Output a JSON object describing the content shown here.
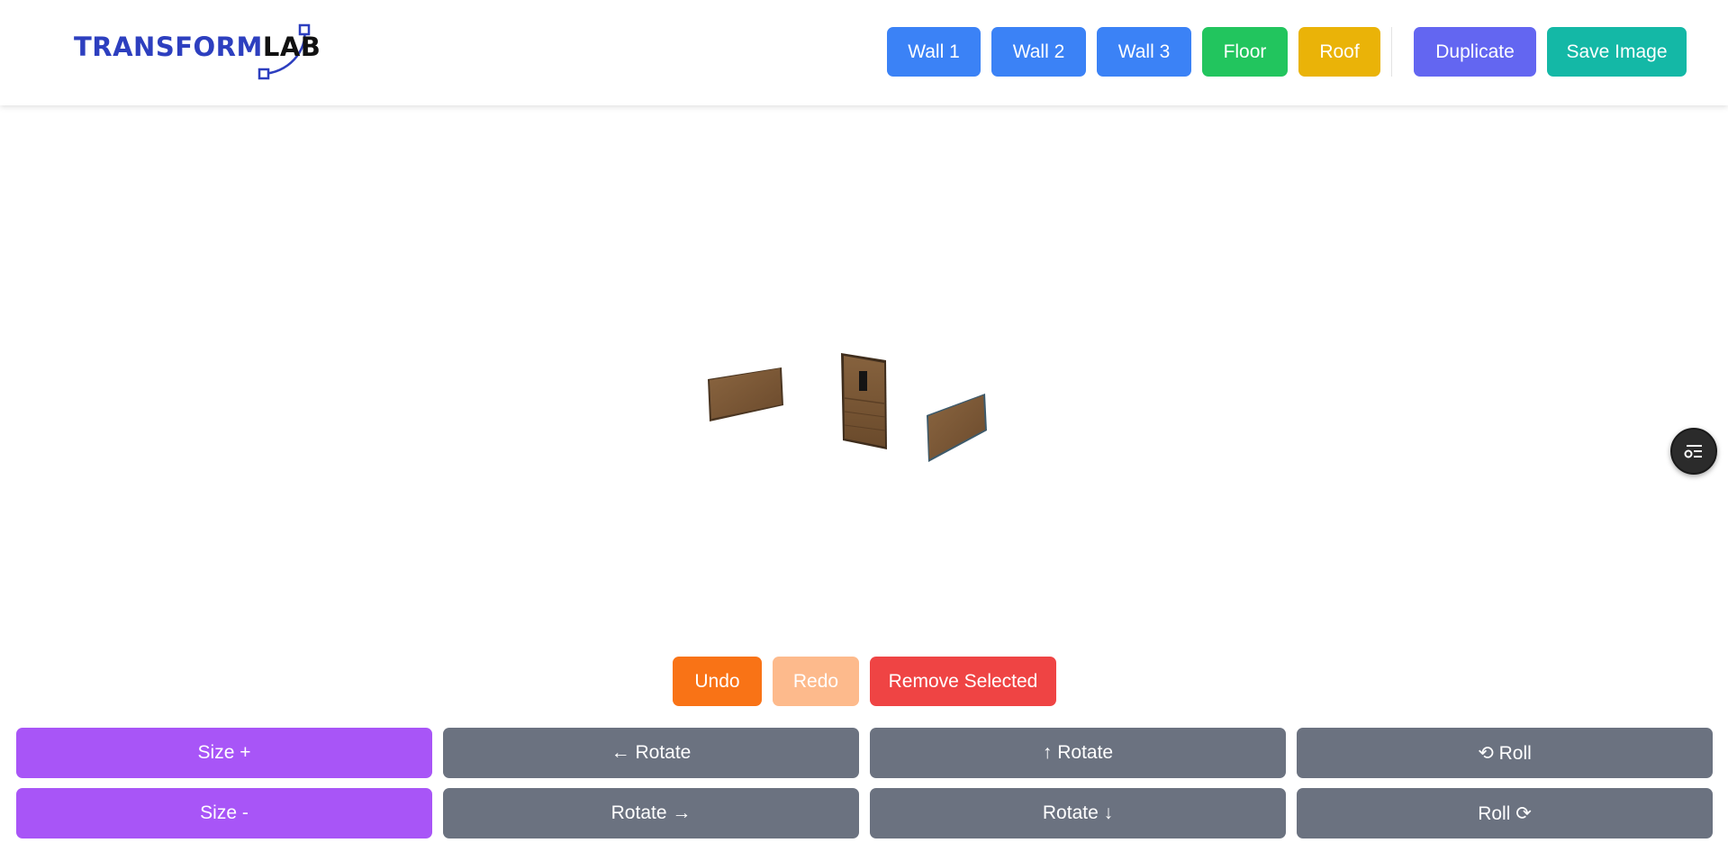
{
  "header": {
    "logo": {
      "part1": "TRANSFORM",
      "part2": "LAB"
    },
    "buttons": {
      "wall1": "Wall 1",
      "wall2": "Wall 2",
      "wall3": "Wall 3",
      "floor": "Floor",
      "roof": "Roof",
      "duplicate": "Duplicate",
      "save_image": "Save Image"
    }
  },
  "actions": {
    "undo": "Undo",
    "redo": "Redo",
    "remove_selected": "Remove Selected"
  },
  "controls": {
    "size_plus": "Size +",
    "size_minus": "Size -",
    "rotate_left": "← Rotate",
    "rotate_right": "Rotate →",
    "rotate_up": "↑ Rotate",
    "rotate_down": "Rotate ↓",
    "roll_ccw": "⟲ Roll",
    "roll_cw": "Roll ⟳"
  },
  "icons": {
    "fab": "settings-list-icon"
  },
  "colors": {
    "wall": "#3b82f6",
    "floor": "#22c55e",
    "roof": "#eab308",
    "duplicate": "#6366f1",
    "save": "#14b8a6",
    "undo": "#f97316",
    "redo_disabled": "#fdba8c",
    "remove": "#ef4444",
    "size": "#a855f7",
    "rotate": "#6b7280",
    "logo_blue": "#2d3fbf"
  }
}
